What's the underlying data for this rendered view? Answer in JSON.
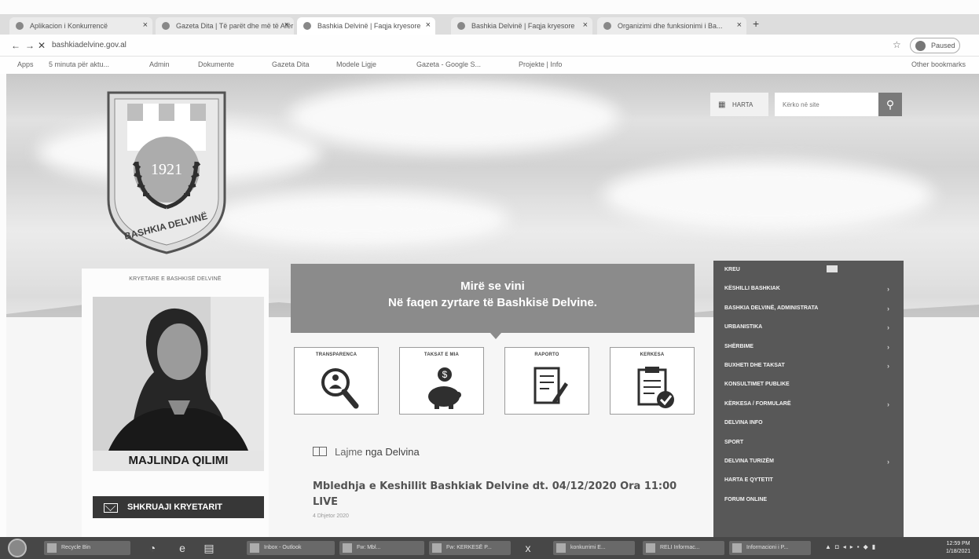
{
  "browser": {
    "tabs": [
      {
        "label": "Aplikacion i Konkurrencë"
      },
      {
        "label": "Gazeta Dita | Të parët dhe më të Afër"
      },
      {
        "label": "Bashkia Delvinë | Faqja kryesore"
      },
      {
        "label": "Bashkia Delvinë | Faqja kryesore"
      },
      {
        "label": "Organizimi dhe funksionimi i Ba..."
      }
    ],
    "url": "bashkiadelvine.gov.al",
    "profile_label": "Paused",
    "bookmarks": [
      "Apps",
      "5 minuta për aktu...",
      "Admin",
      "Dokumente",
      "Gazeta Dita",
      "Modele Ligje",
      "Gazeta - Google S...",
      "Projekte | Info"
    ],
    "other_bookmarks": "Other bookmarks"
  },
  "site": {
    "logo": {
      "year": "1921",
      "text": "BASHKIA DELVINË"
    },
    "map_label": "HARTA",
    "search_placeholder": "Kërko në site",
    "mayor": {
      "caption": "KRYETARE E BASHKISË DELVINË",
      "name": "MAJLINDA QILIMI",
      "button": "SHKRUAJI KRYETARIT"
    },
    "welcome": {
      "line1": "Mirë se vini",
      "line2": "Në faqen zyrtare të Bashkisë Delvine."
    },
    "services": [
      {
        "label": "TRANSPARENCA"
      },
      {
        "label": "TAKSAT E MIA"
      },
      {
        "label": "RAPORTO"
      },
      {
        "label": "KERKESA"
      }
    ],
    "news": {
      "heading_prefix": "Lajme",
      "heading_suffix": "nga Delvina",
      "title": "Mbledhja e Keshillit Bashkiak Delvine dt. 04/12/2020 Ora 11:00 LIVE",
      "date": "4 Dhjetor 2020"
    },
    "nav": [
      {
        "label": "KREU",
        "has_sub": false
      },
      {
        "label": "KËSHILLI BASHKIAK",
        "has_sub": true
      },
      {
        "label": "BASHKIA DELVINË, ADMINISTRATA",
        "has_sub": true
      },
      {
        "label": "URBANISTIKA",
        "has_sub": true
      },
      {
        "label": "SHËRBIME",
        "has_sub": true
      },
      {
        "label": "BUXHETI DHE TAKSAT",
        "has_sub": true
      },
      {
        "label": "KONSULTIMET PUBLIKE",
        "has_sub": false
      },
      {
        "label": "KËRKESA / FORMULARË",
        "has_sub": true
      },
      {
        "label": "DELVINA INFO",
        "has_sub": false
      },
      {
        "label": "SPORT",
        "has_sub": false
      },
      {
        "label": "DELVINA TURIZËM",
        "has_sub": true
      },
      {
        "label": "HARTA E QYTETIT",
        "has_sub": false
      },
      {
        "label": "FORUM ONLINE",
        "has_sub": false
      }
    ]
  },
  "taskbar": {
    "items": [
      "Recycle Bin",
      "Inbox - Outlook",
      "Fw: Mbl...",
      "Fw: KERKESË P...",
      "konkurrimi E...",
      "RELI Informac...",
      "Informacioni i P..."
    ],
    "time": "12:59 PM",
    "date": "1/18/2021"
  }
}
